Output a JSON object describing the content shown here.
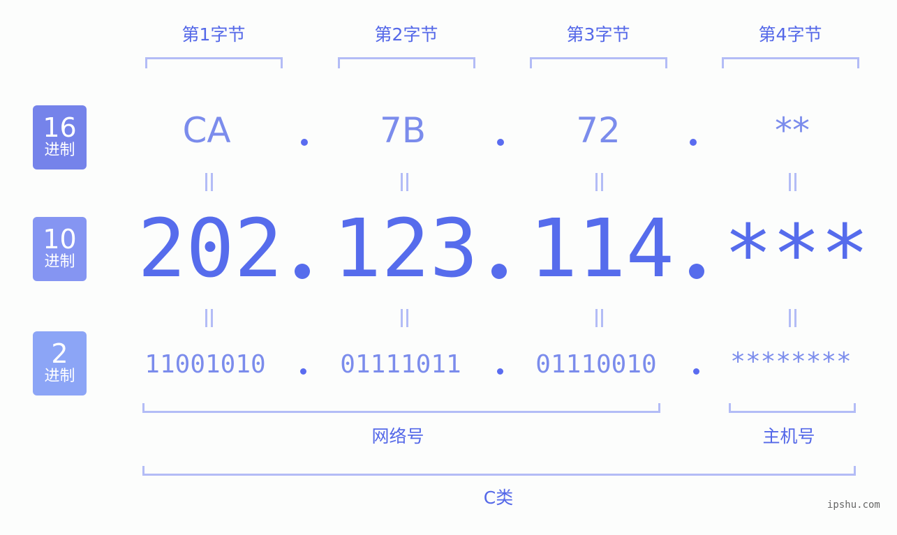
{
  "bytes": [
    {
      "title": "第1字节",
      "hex": "CA",
      "dec": "202",
      "bin": "11001010"
    },
    {
      "title": "第2字节",
      "hex": "7B",
      "dec": "123",
      "bin": "01111011"
    },
    {
      "title": "第3字节",
      "hex": "72",
      "dec": "114",
      "bin": "01110010"
    },
    {
      "title": "第4字节",
      "hex": "**",
      "dec": "***",
      "bin": "********"
    }
  ],
  "rows": {
    "hex": {
      "num": "16",
      "label": "进制",
      "color": "#7583ea"
    },
    "dec": {
      "num": "10",
      "label": "进制",
      "color": "#8595f2"
    },
    "bin": {
      "num": "2",
      "label": "进制",
      "color": "#8ca5f6"
    }
  },
  "separator": ".",
  "groups": {
    "network": "网络号",
    "host": "主机号",
    "class": "C类"
  },
  "watermark": "ipshu.com",
  "colors": {
    "accent": "#566cec",
    "light": "#7b8cec",
    "bracket": "#b3bcf6"
  }
}
